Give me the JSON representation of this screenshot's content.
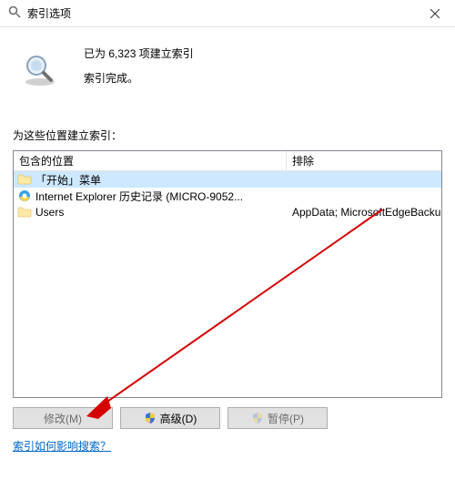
{
  "window": {
    "title": "索引选项"
  },
  "status": {
    "count_line": "已为 6,323 项建立索引",
    "done_line": "索引完成。"
  },
  "section_label": "为这些位置建立索引：",
  "columns": {
    "included": "包含的位置",
    "excluded": "排除"
  },
  "rows": [
    {
      "icon": "folder",
      "label": "「开始」菜单",
      "exclude": "",
      "selected": true
    },
    {
      "icon": "ie",
      "label": "Internet Explorer 历史记录 (MICRO-9052...",
      "exclude": "",
      "selected": false
    },
    {
      "icon": "folder",
      "label": "Users",
      "exclude": "AppData; MicrosoftEdgeBackups; AppData",
      "selected": false
    }
  ],
  "buttons": {
    "modify": "修改(M)",
    "advanced": "高级(D)",
    "pause": "暂停(P)"
  },
  "help_link": "索引如何影响搜索？"
}
